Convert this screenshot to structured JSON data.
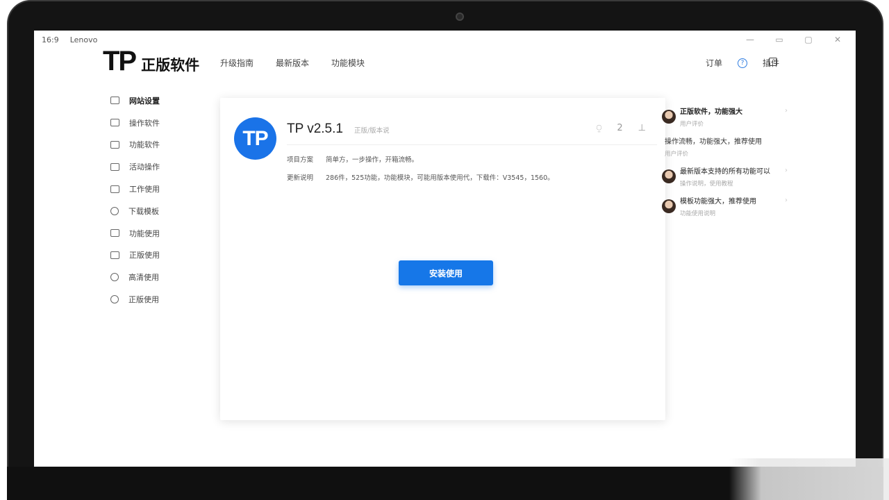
{
  "system": {
    "ratio": "16:9",
    "device": "Lenovo"
  },
  "brand": {
    "mark": "TP",
    "name": "正版软件",
    "accent": "#1677e8"
  },
  "topnav": [
    "升级指南",
    "最新版本",
    "功能模块"
  ],
  "topright": {
    "item1": "订单",
    "item2": "插件"
  },
  "sidebar": [
    {
      "label": "网站设置",
      "icon": "list-icon",
      "active": true
    },
    {
      "label": "操作软件",
      "icon": "stack-icon"
    },
    {
      "label": "功能软件",
      "icon": "list-icon"
    },
    {
      "label": "活动操作",
      "icon": "stack-icon"
    },
    {
      "label": "工作使用",
      "icon": "hat-icon"
    },
    {
      "label": "下载模板",
      "icon": "smile-icon"
    },
    {
      "label": "功能使用",
      "icon": "list-icon"
    },
    {
      "label": "正版使用",
      "icon": "home-icon"
    },
    {
      "label": "高清使用",
      "icon": "cloud-icon"
    },
    {
      "label": "正版使用",
      "icon": "clock-icon"
    }
  ],
  "card": {
    "badge": "TP",
    "title": "TP v2.5.1",
    "subtitle": "正版/版本说",
    "tool_count": "2",
    "info": [
      {
        "label": "项目方案",
        "value": "简单方，一步操作，开箱流畅。"
      },
      {
        "label": "更新说明",
        "value": "286件，525功能，功能模块，可能用版本使用代，下载件：V3545，1560。"
      }
    ],
    "button": "安装使用"
  },
  "comments": [
    {
      "title": "正版软件，功能强大",
      "sub": "用户评价"
    },
    {
      "text": "操作流畅，功能强大，推荐使用",
      "sub": "用户评价"
    },
    {
      "title": "最新版本支持的所有功能可以",
      "sub": "操作说明，使用教程"
    },
    {
      "title": "模板功能强大，推荐使用",
      "sub": "功能使用说明"
    }
  ]
}
